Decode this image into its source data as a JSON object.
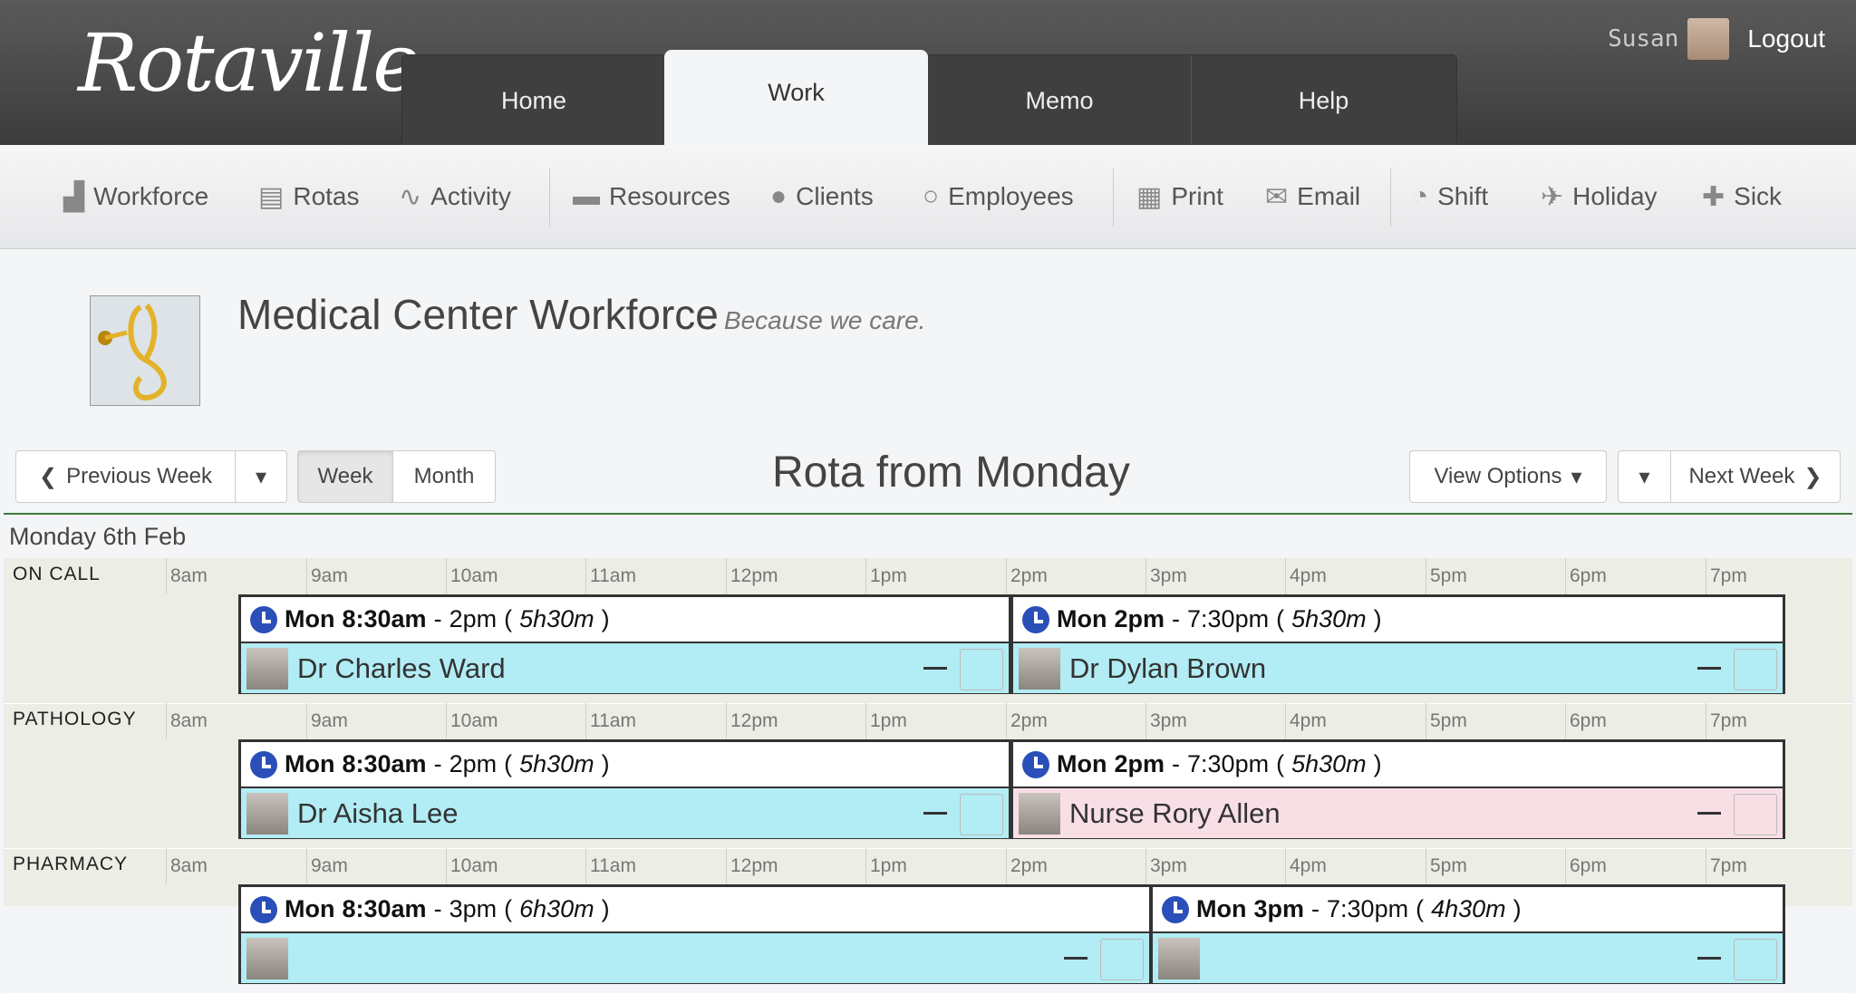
{
  "app": {
    "logo": "Rotaville"
  },
  "tabs": [
    {
      "label": "Home"
    },
    {
      "label": "Work"
    },
    {
      "label": "Memo"
    },
    {
      "label": "Help"
    }
  ],
  "user": {
    "name": "Susan",
    "logout": "Logout"
  },
  "toolbar": [
    {
      "label": "Workforce",
      "icon": "chart-icon"
    },
    {
      "label": "Rotas",
      "icon": "clipboard-icon"
    },
    {
      "label": "Activity",
      "icon": "pulse-icon"
    },
    {
      "label": "Resources",
      "icon": "truck-icon"
    },
    {
      "label": "Clients",
      "icon": "client-icon"
    },
    {
      "label": "Employees",
      "icon": "user-icon"
    },
    {
      "label": "Print",
      "icon": "printer-icon"
    },
    {
      "label": "Email",
      "icon": "envelope-icon"
    },
    {
      "label": "Shift",
      "icon": "clock-icon"
    },
    {
      "label": "Holiday",
      "icon": "plane-icon"
    },
    {
      "label": "Sick",
      "icon": "medkit-icon"
    }
  ],
  "workforce": {
    "title": "Medical Center Workforce",
    "tagline": "Because we care."
  },
  "nav": {
    "previous": "Previous Week",
    "week": "Week",
    "month": "Month",
    "title": "Rota from Monday",
    "view_options": "View Options",
    "next": "Next Week"
  },
  "day": "Monday 6th Feb",
  "hours": [
    "8am",
    "9am",
    "10am",
    "11am",
    "12pm",
    "1pm",
    "2pm",
    "3pm",
    "4pm",
    "5pm",
    "6pm",
    "7pm"
  ],
  "rows": [
    {
      "label": "ON CALL",
      "shifts": [
        {
          "day": "Mon",
          "start": "8:30am",
          "end": "2pm",
          "duration": "5h30m",
          "person": "Dr Charles Ward",
          "color": "#b2ecf4"
        },
        {
          "day": "Mon",
          "start": "2pm",
          "end": "7:30pm",
          "duration": "5h30m",
          "person": "Dr Dylan Brown",
          "color": "#b2ecf4"
        }
      ]
    },
    {
      "label": "PATHOLOGY",
      "shifts": [
        {
          "day": "Mon",
          "start": "8:30am",
          "end": "2pm",
          "duration": "5h30m",
          "person": "Dr Aisha Lee",
          "color": "#b2ecf4"
        },
        {
          "day": "Mon",
          "start": "2pm",
          "end": "7:30pm",
          "duration": "5h30m",
          "person": "Nurse Rory Allen",
          "color": "#f8dfe6"
        }
      ]
    },
    {
      "label": "PHARMACY",
      "shifts": [
        {
          "day": "Mon",
          "start": "8:30am",
          "end": "3pm",
          "duration": "6h30m",
          "person": "",
          "color": "#b2ecf4"
        },
        {
          "day": "Mon",
          "start": "3pm",
          "end": "7:30pm",
          "duration": "4h30m",
          "person": "",
          "color": "#b2ecf4"
        }
      ]
    }
  ]
}
